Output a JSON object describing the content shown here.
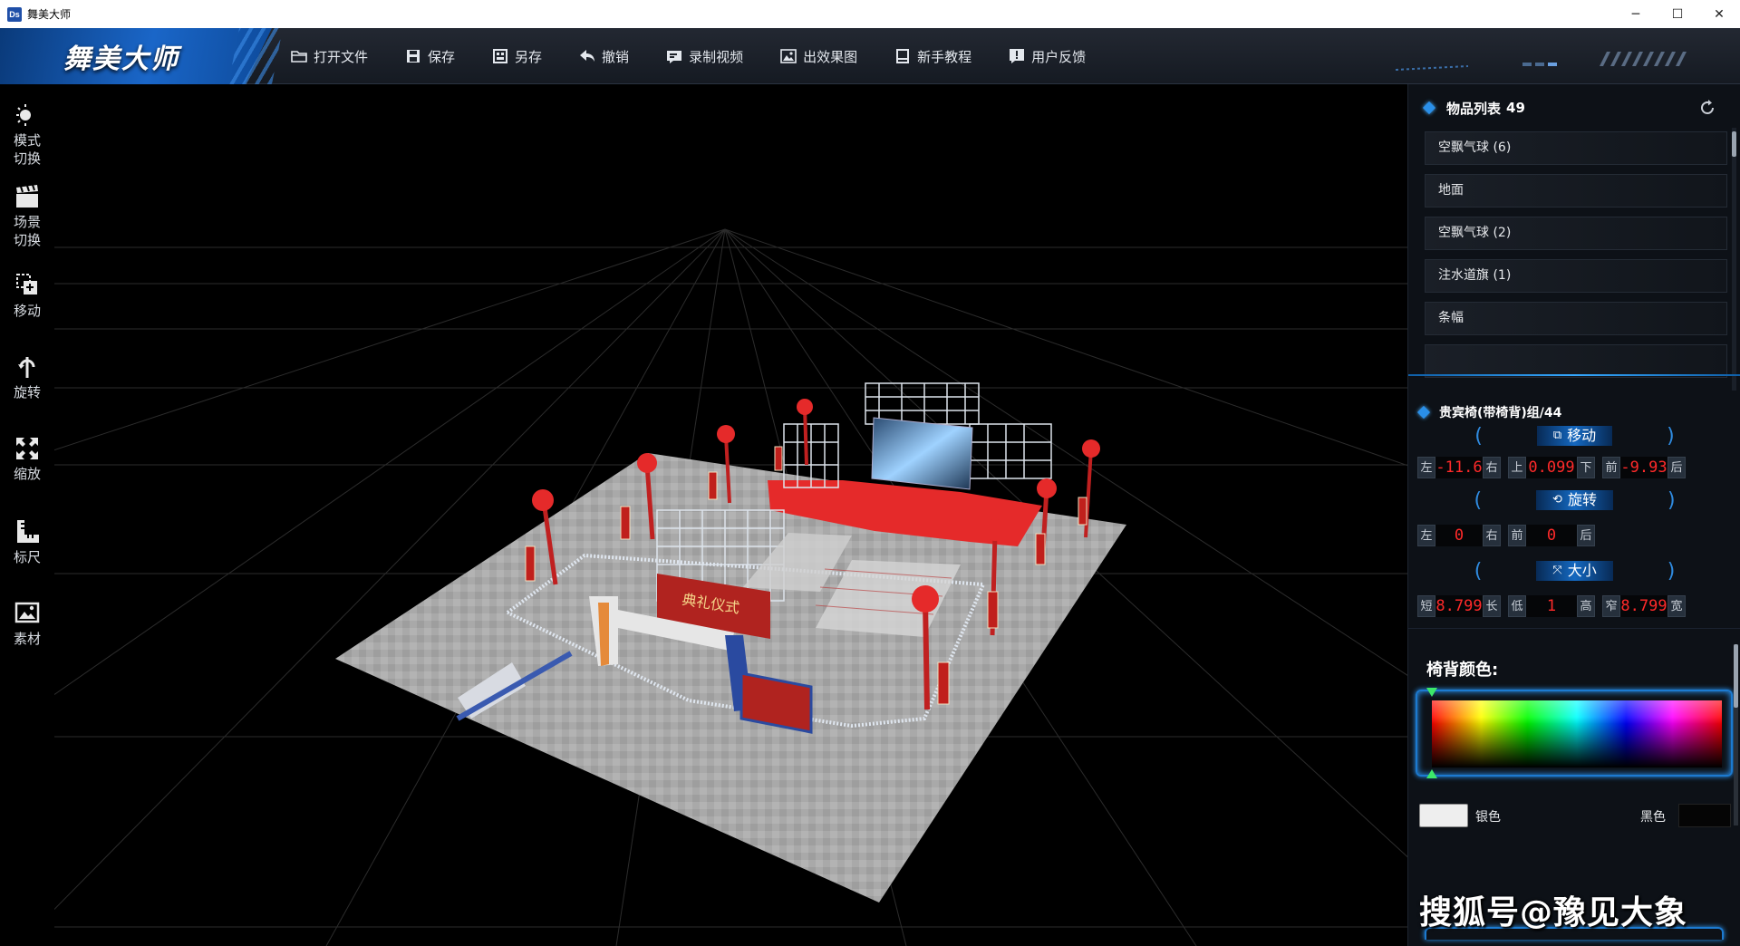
{
  "window": {
    "title": "舞美大师",
    "app_icon": "Ds",
    "controls": [
      "─",
      "☐",
      "✕"
    ]
  },
  "toolbar": {
    "brand": "舞美大师",
    "items": [
      {
        "label": "打开文件",
        "icon": "folder-icon"
      },
      {
        "label": "保存",
        "icon": "save-icon"
      },
      {
        "label": "另存",
        "icon": "save-as-icon"
      },
      {
        "label": "撤销",
        "icon": "undo-icon"
      },
      {
        "label": "录制视频",
        "icon": "record-video-icon"
      },
      {
        "label": "出效果图",
        "icon": "image-icon"
      },
      {
        "label": "新手教程",
        "icon": "book-icon"
      },
      {
        "label": "用户反馈",
        "icon": "feedback-icon"
      }
    ]
  },
  "left_tools": [
    {
      "label": "模式\n切换",
      "icon": "mode-switch-icon"
    },
    {
      "label": "场景\n切换",
      "icon": "scene-switch-icon"
    },
    {
      "label": "移动",
      "icon": "move-icon"
    },
    {
      "label": "旋转",
      "icon": "rotate-icon"
    },
    {
      "label": "缩放",
      "icon": "scale-icon"
    },
    {
      "label": "标尺",
      "icon": "ruler-icon"
    },
    {
      "label": "素材",
      "icon": "material-icon"
    }
  ],
  "object_list": {
    "title": "物品列表",
    "count": "49",
    "items": [
      "空飘气球 (6)",
      "地面",
      "空飘气球 (2)",
      "注水道旗 (1)",
      "条幅"
    ]
  },
  "selected": {
    "name": "贵宾椅(带椅背)组/44",
    "move": {
      "title": "移动",
      "lr_left": "左",
      "lr_value": "-11.6",
      "lr_right": "右",
      "ud_up": "上",
      "ud_value": "0.099",
      "ud_down": "下",
      "fb_front": "前",
      "fb_value": "-9.93",
      "fb_back": "后"
    },
    "rotate": {
      "title": "旋转",
      "a_left": "左",
      "a_value": "0",
      "a_right": "右",
      "b_front": "前",
      "b_value": "0",
      "b_back": "后"
    },
    "size": {
      "title": "大小",
      "a_short": "短",
      "a_value": "8.799",
      "a_long": "长",
      "b_low": "低",
      "b_value": "1",
      "b_high": "高",
      "c_narrow": "窄",
      "c_value": "8.799",
      "c_wide": "宽"
    }
  },
  "color": {
    "label": "椅背颜色:",
    "swatch_a_label": "银色",
    "swatch_a_color": "#eeeeee",
    "swatch_b_label": "黑色",
    "swatch_b_color": "#050505"
  },
  "scene": {
    "banner_text": "典礼仪式"
  },
  "watermark": "搜狐号@豫见大象",
  "colors": {
    "accent": "#1a66c8",
    "value_red": "#ff2a2a",
    "stage_red": "#e52a2a"
  }
}
